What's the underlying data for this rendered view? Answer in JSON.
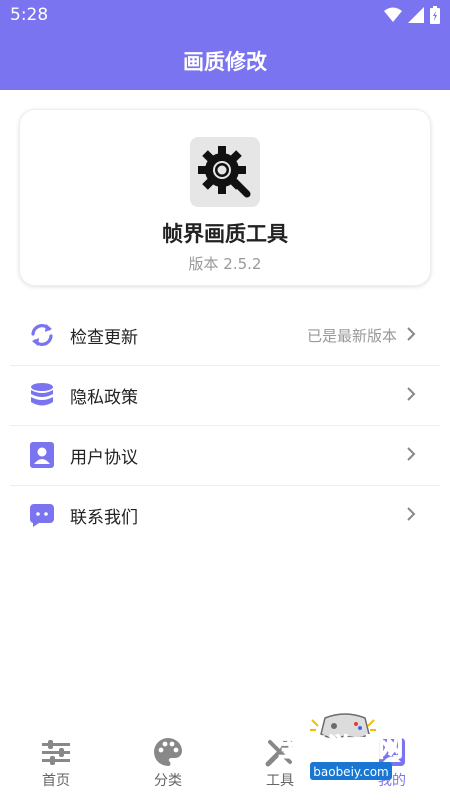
{
  "status_bar": {
    "time": "5:28"
  },
  "app_bar": {
    "title": "画质修改"
  },
  "app_card": {
    "name": "帧界画质工具",
    "version": "版本 2.5.2",
    "icon": "gear-magnifier-icon"
  },
  "menu": [
    {
      "label": "检查更新",
      "value": "已是最新版本",
      "icon": "refresh-icon"
    },
    {
      "label": "隐私政策",
      "value": "",
      "icon": "database-icon"
    },
    {
      "label": "用户协议",
      "value": "",
      "icon": "user-card-icon"
    },
    {
      "label": "联系我们",
      "value": "",
      "icon": "chat-icon"
    }
  ],
  "bottom_nav": [
    {
      "label": "首页",
      "icon": "sliders-icon",
      "active": false
    },
    {
      "label": "分类",
      "icon": "palette-icon",
      "active": false
    },
    {
      "label": "工具",
      "icon": "wrench-icon",
      "active": false
    },
    {
      "label": "我的",
      "icon": "profile-icon",
      "active": true
    }
  ],
  "watermark": {
    "text": "宝贝游戏网",
    "url": "baobeiy.com"
  },
  "colors": {
    "accent": "#7b74f0",
    "text": "#222222",
    "muted": "#999999"
  }
}
